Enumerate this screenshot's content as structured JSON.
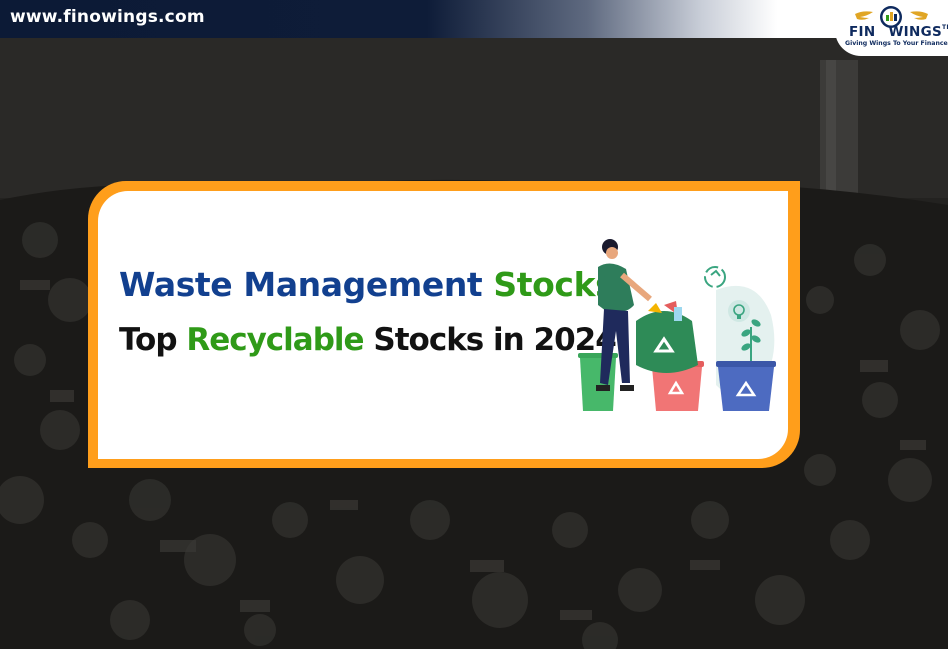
{
  "header": {
    "site_url": "www.finowings.com",
    "logo": {
      "brand_prefix": "FIN",
      "brand_suffix": "WINGS",
      "trademark": "TM",
      "tagline": "Giving Wings To Your Finance"
    }
  },
  "banner": {
    "title_line1": {
      "part1": "Waste Management",
      "part2": "Stocks:"
    },
    "title_line2": {
      "part1": "Top",
      "part2": "Recyclable",
      "part3": "Stocks in 2024"
    }
  },
  "illustration": {
    "icons": [
      "person-icon",
      "garbage-bag-icon",
      "recycle-bin-icon",
      "recycle-icon",
      "lightbulb-icon",
      "plant-icon"
    ]
  },
  "colors": {
    "frame_orange": "#ff9e1b",
    "title_blue": "#12408f",
    "title_green": "#2f9a18",
    "header_navy": "#0c1a36"
  }
}
